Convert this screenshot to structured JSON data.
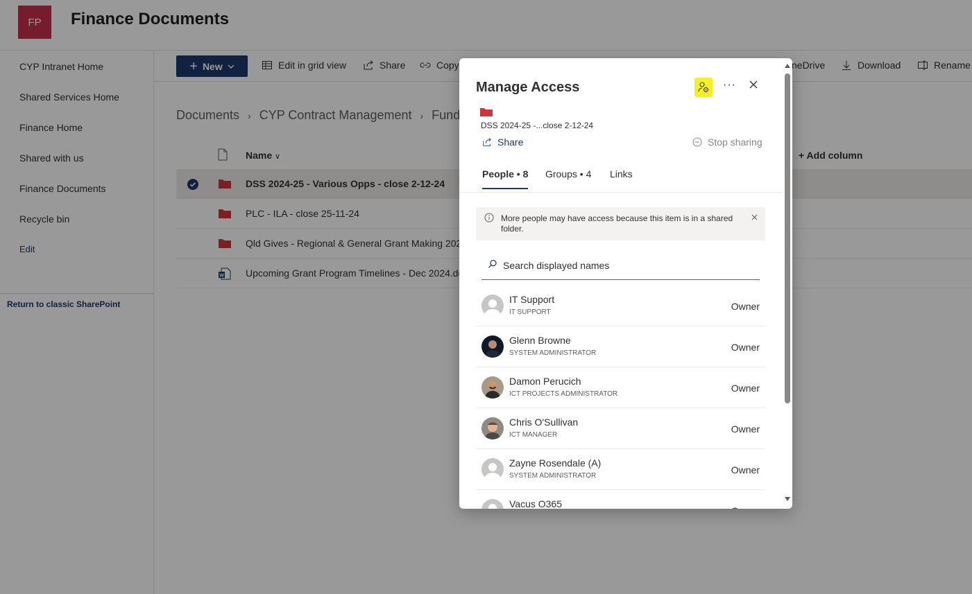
{
  "site": {
    "logo_text": "FP",
    "title": "Finance Documents"
  },
  "nav": {
    "items": [
      "CYP Intranet Home",
      "Shared Services Home",
      "Finance Home",
      "Shared with us",
      "Finance Documents",
      "Recycle bin",
      "Edit"
    ],
    "classic_link": "Return to classic SharePoint"
  },
  "commandbar": {
    "new_label": "New",
    "edit_grid": "Edit in grid view",
    "share": "Share",
    "copy": "Copy",
    "onedrive": "neDrive",
    "download": "Download",
    "rename": "Rename"
  },
  "breadcrumb": [
    "Documents",
    "CYP Contract Management",
    "Fundin"
  ],
  "list": {
    "col_name": "Name",
    "col_add": "Add column",
    "rows": [
      {
        "name": "DSS 2024-25 - Various Opps - close 2-12-24",
        "type": "folder"
      },
      {
        "name": "PLC - ILA - close 25-11-24",
        "type": "folder"
      },
      {
        "name": "Qld Gives - Regional & General Grant Making 202",
        "type": "folder"
      },
      {
        "name": "Upcoming Grant Program Timelines - Dec 2024.do",
        "type": "word"
      }
    ]
  },
  "dialog": {
    "title": "Manage Access",
    "item_name": "DSS 2024-25 -...close 2-12-24",
    "share_label": "Share",
    "stop_sharing_label": "Stop sharing",
    "more_label": "···",
    "tabs": [
      {
        "label": "People • 8"
      },
      {
        "label": "Groups • 4"
      },
      {
        "label": "Links"
      }
    ],
    "notice": "More people may have access because this item is in a shared folder.",
    "search_placeholder": "Search displayed names",
    "people": [
      {
        "name": "IT Support",
        "title": "IT SUPPORT",
        "role": "Owner"
      },
      {
        "name": "Glenn Browne",
        "title": "SYSTEM ADMINISTRATOR",
        "role": "Owner"
      },
      {
        "name": "Damon Perucich",
        "title": "ICT PROJECTS ADMINISTRATOR",
        "role": "Owner"
      },
      {
        "name": "Chris O'Sullivan",
        "title": "ICT MANAGER",
        "role": "Owner"
      },
      {
        "name": "Zayne Rosendale (A)",
        "title": "SYSTEM ADMINISTRATOR",
        "role": "Owner"
      },
      {
        "name": "Vacus O365",
        "title": "",
        "role": "Owner"
      }
    ]
  },
  "colors": {
    "brand": "#1b3a6b",
    "logo": "#c4314b",
    "folder": "#d13438",
    "highlight": "#f6f022"
  }
}
